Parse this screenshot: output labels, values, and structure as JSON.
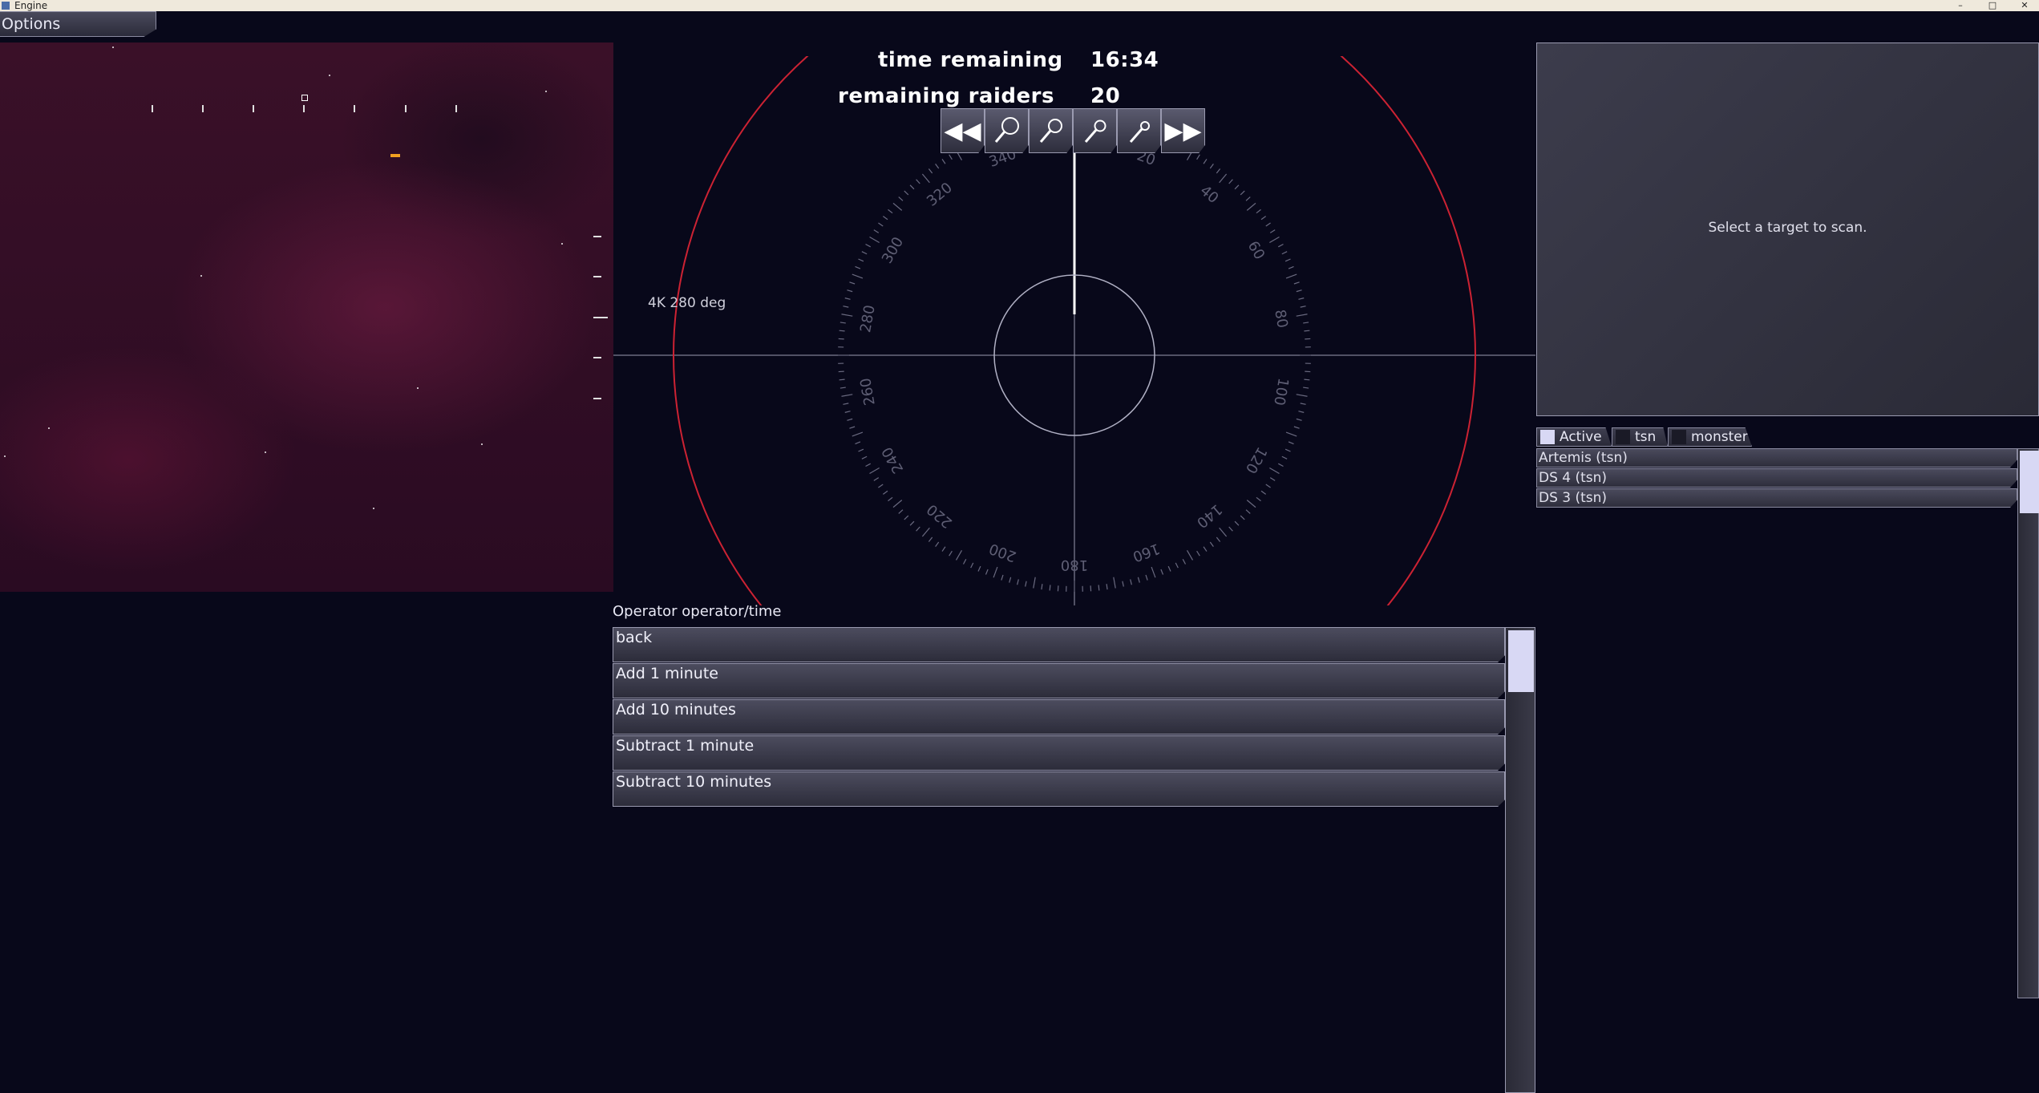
{
  "window": {
    "title": "Engine",
    "minimize": "–",
    "maximize": "□",
    "close": "✕"
  },
  "options": {
    "label": "Options"
  },
  "hud": {
    "time_label": "time remaining",
    "time_value": "16:34",
    "raiders_label": "remaining raiders",
    "raiders_value": "20"
  },
  "toolbar": {
    "icons": [
      "rewind-icon",
      "zoom-icon",
      "zoom-icon",
      "zoom-icon",
      "zoom-icon",
      "fast-forward-icon"
    ]
  },
  "radar": {
    "range_label": "4K   280 deg",
    "heading_labels": [
      "340",
      "20",
      "40",
      "60",
      "80",
      "100",
      "120",
      "140",
      "160",
      "180",
      "200",
      "220",
      "240",
      "260",
      "280",
      "300",
      "320"
    ],
    "ring_color": "#cc2233"
  },
  "scan": {
    "prompt": "Select a target to scan."
  },
  "filters": [
    {
      "label": "Active",
      "checked": true
    },
    {
      "label": "tsn",
      "checked": false
    },
    {
      "label": "monster",
      "checked": false
    }
  ],
  "contacts": [
    "Artemis (tsn)",
    "DS 4 (tsn)",
    "DS 3 (tsn)"
  ],
  "operator": {
    "title": "Operator operator/time",
    "items": [
      "back",
      "Add 1 minute",
      "Add 10 minutes",
      "Subtract 1 minute",
      "Subtract 10 minutes"
    ]
  }
}
